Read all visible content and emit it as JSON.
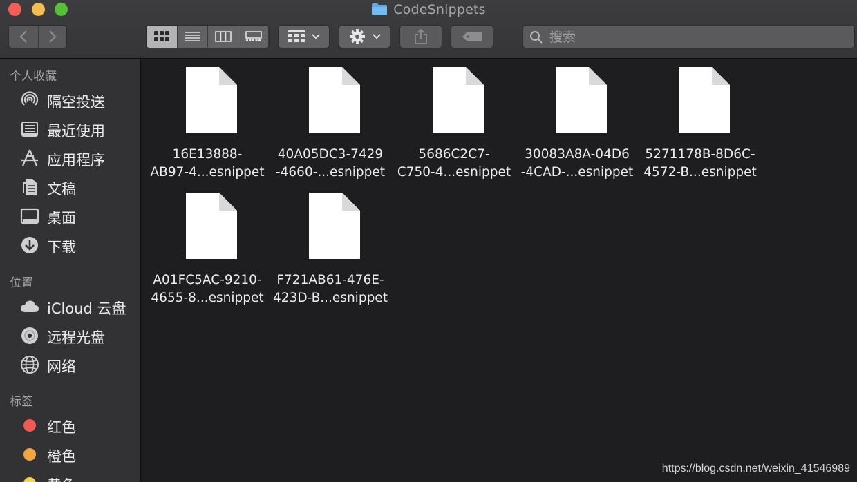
{
  "window": {
    "title": "CodeSnippets"
  },
  "toolbar": {
    "back_icon": "chevron-left-icon",
    "forward_icon": "chevron-right-icon",
    "view_modes": [
      "icon-view",
      "list-view",
      "column-view",
      "gallery-view"
    ],
    "active_view": "icon-view",
    "group_icon": "group-grid-icon",
    "action_icon": "gear-icon",
    "share_icon": "share-icon",
    "tag_icon": "tag-icon",
    "search_placeholder": "搜索"
  },
  "sidebar": {
    "favorites_title": "个人收藏",
    "favorites": [
      {
        "label": "隔空投送",
        "icon": "airdrop-icon"
      },
      {
        "label": "最近使用",
        "icon": "recents-icon"
      },
      {
        "label": "应用程序",
        "icon": "applications-icon"
      },
      {
        "label": "文稿",
        "icon": "documents-icon"
      },
      {
        "label": "桌面",
        "icon": "desktop-icon"
      },
      {
        "label": "下载",
        "icon": "downloads-icon"
      }
    ],
    "locations_title": "位置",
    "locations": [
      {
        "label": "iCloud 云盘",
        "icon": "icloud-icon"
      },
      {
        "label": "远程光盘",
        "icon": "remote-disc-icon"
      },
      {
        "label": "网络",
        "icon": "network-icon"
      }
    ],
    "tags_title": "标签",
    "tags": [
      {
        "label": "红色",
        "color": "#f05a55"
      },
      {
        "label": "橙色",
        "color": "#f5a540"
      },
      {
        "label": "黄色",
        "color": "#f6d245"
      }
    ]
  },
  "files": [
    {
      "line1": "16E13888-",
      "line2": "AB97-4...esnippet"
    },
    {
      "line1": "40A05DC3-7429",
      "line2": "-4660-...esnippet"
    },
    {
      "line1": "5686C2C7-",
      "line2": "C750-4...esnippet"
    },
    {
      "line1": "30083A8A-04D6",
      "line2": "-4CAD-...esnippet"
    },
    {
      "line1": "5271178B-8D6C-",
      "line2": "4572-B...esnippet"
    },
    {
      "line1": "A01FC5AC-9210-",
      "line2": "4655-8...esnippet"
    },
    {
      "line1": "F721AB61-476E-",
      "line2": "423D-B...esnippet"
    }
  ],
  "watermark": "https://blog.csdn.net/weixin_41546989"
}
